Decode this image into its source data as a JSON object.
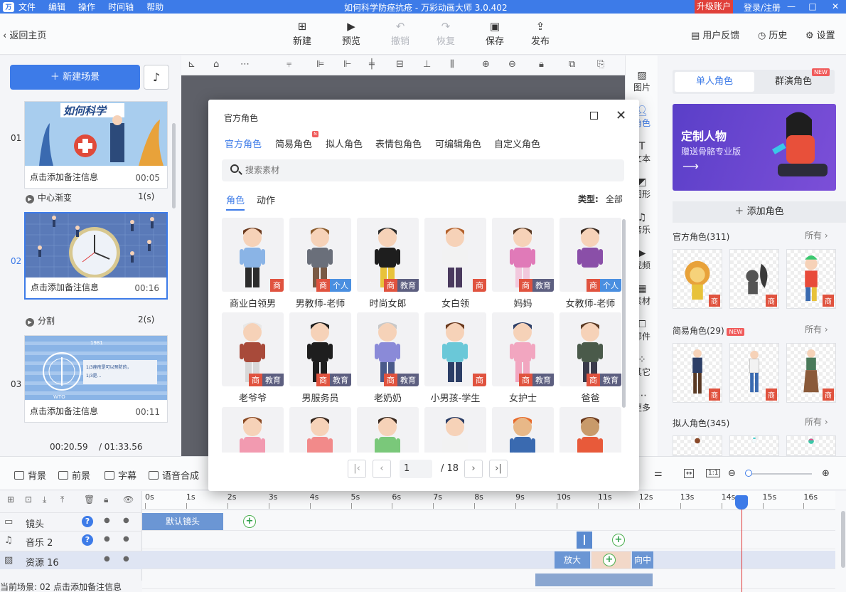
{
  "titlebar": {
    "logo": "万",
    "menus": [
      "文件",
      "编辑",
      "操作",
      "时间轴",
      "帮助"
    ],
    "title": "如何科学防痤抗疮 - 万彩动画大师 3.0.402",
    "upgrade": "升级账户",
    "login": "登录/注册",
    "window_buttons": [
      "—",
      "□",
      "✕"
    ]
  },
  "toolbar": {
    "back": "返回主页",
    "buttons": [
      {
        "label": "新建",
        "icon": "plus-square-icon"
      },
      {
        "label": "预览",
        "icon": "play-icon"
      },
      {
        "label": "撤销",
        "icon": "undo-icon",
        "disabled": true
      },
      {
        "label": "恢复",
        "icon": "redo-icon",
        "disabled": true
      },
      {
        "label": "保存",
        "icon": "save-icon"
      },
      {
        "label": "发布",
        "icon": "publish-icon"
      }
    ],
    "right": [
      "用户反馈",
      "历史",
      "设置"
    ]
  },
  "left": {
    "new_scene": "新建场景",
    "scenes": [
      {
        "num": "01",
        "note": "点击添加备注信息",
        "duration": "00:05",
        "thumb_title": "如何科学",
        "transition": "中心渐变",
        "transition_time": "1(s)"
      },
      {
        "num": "02",
        "note": "点击添加备注信息",
        "duration": "00:16",
        "transition": "分割",
        "transition_time": "2(s)"
      },
      {
        "num": "03",
        "note": "点击添加备注信息",
        "duration": "00:11",
        "thumb_title": "1981",
        "thumb_sub": "WTO",
        "thumb_text1": "1/3痤疮是可以预防的，",
        "thumb_text2": "1/3是..."
      }
    ],
    "current_time": "00:20.59",
    "total_time": "/ 01:33.56"
  },
  "iconstrip": [
    {
      "label": "图片",
      "icon": "image-icon"
    },
    {
      "label": "角色",
      "icon": "character-icon",
      "active": true
    },
    {
      "label": "文本",
      "icon": "text-icon"
    },
    {
      "label": "图形",
      "icon": "shape-icon"
    },
    {
      "label": "音乐",
      "icon": "music-icon"
    },
    {
      "label": "视频",
      "icon": "video-icon"
    },
    {
      "label": "素材",
      "icon": "material-icon"
    },
    {
      "label": "部件",
      "icon": "widget-icon"
    },
    {
      "label": "其它",
      "icon": "other-icon"
    },
    {
      "label": "更多",
      "icon": "more-icon"
    }
  ],
  "right": {
    "tabs": [
      "单人角色",
      "群演角色"
    ],
    "new_badge": "NEW",
    "banner_title": "定制人物",
    "banner_sub": "赠送骨骼专业版",
    "add_role": "添加角色",
    "sections": [
      {
        "title": "官方角色(311)",
        "more": "所有"
      },
      {
        "title": "简易角色(29)",
        "more": "所有",
        "badge": "NEW"
      },
      {
        "title": "拟人角色(345)",
        "more": "所有"
      }
    ],
    "tag": "商"
  },
  "layerbar": {
    "items": [
      "背景",
      "前景",
      "字幕",
      "语音合成"
    ]
  },
  "timeline": {
    "tracks": [
      {
        "label": "镜头",
        "icon": "camera-icon"
      },
      {
        "label": "音乐 2",
        "icon": "music-icon"
      },
      {
        "label": "资源 16",
        "icon": "image-icon"
      }
    ],
    "ticks": [
      "0s",
      "1s",
      "2s",
      "3s",
      "4s",
      "5s",
      "6s",
      "7s",
      "8s",
      "9s",
      "10s",
      "11s",
      "12s",
      "13s",
      "14s",
      "15s",
      "16s"
    ],
    "default_lens": "默认镜头",
    "clip_zoom": "放大",
    "clip_center": "向中",
    "status": "当前场景: 02   点击添加备注信息"
  },
  "dialog": {
    "title": "官方角色",
    "tabs": [
      "官方角色",
      "简易角色",
      "拟人角色",
      "表情包角色",
      "可编辑角色",
      "自定义角色"
    ],
    "new_dot": "N",
    "search_placeholder": "搜索素材",
    "subtabs": [
      "角色",
      "动作"
    ],
    "type_label": "类型:",
    "type_value": "全部",
    "tags": {
      "shang": "商",
      "jiaoyu": "教育",
      "geren": "个人"
    },
    "characters": [
      {
        "name": "商业白领男",
        "tags": [
          "shang"
        ],
        "shirt": "#8ab4e6",
        "pants": "#2c2c2c",
        "hair": "#6b3a1e",
        "skin": "#f6d2b8"
      },
      {
        "name": "男教师-老师",
        "tags": [
          "shang",
          "geren"
        ],
        "shirt": "#6a6f7a",
        "pants": "#7a5a44",
        "hair": "#8a5a2b",
        "skin": "#f6d2b8"
      },
      {
        "name": "时尚女郎",
        "tags": [
          "shang",
          "jiaoyu"
        ],
        "shirt": "#1e1e1e",
        "pants": "#e8c23a",
        "hair": "#2b2b2b",
        "skin": "#f6d2b8"
      },
      {
        "name": "女白领",
        "tags": [
          "shang"
        ],
        "shirt": "#f2f2f2",
        "pants": "#4a3a5e",
        "hair": "#b3612c",
        "skin": "#f6d2b8"
      },
      {
        "name": "妈妈",
        "tags": [
          "shang",
          "jiaoyu"
        ],
        "shirt": "#e07ab8",
        "pants": "#f2c8dd",
        "hair": "#5a3a24",
        "skin": "#f6d2b8"
      },
      {
        "name": "女教师-老师",
        "tags": [
          "shang",
          "geren"
        ],
        "shirt": "#8a4fa8",
        "pants": "#f2f2f2",
        "hair": "#3a2a20",
        "skin": "#f6d2b8"
      },
      {
        "name": "老爷爷",
        "tags": [
          "shang",
          "jiaoyu"
        ],
        "shirt": "#a84a3a",
        "pants": "#d8d8d8",
        "hair": "#e8e8e8",
        "skin": "#f6d2b8"
      },
      {
        "name": "男服务员",
        "tags": [
          "shang",
          "jiaoyu"
        ],
        "shirt": "#1e1e1e",
        "pants": "#1e1e1e",
        "hair": "#1e1e1e",
        "skin": "#f6d2b8"
      },
      {
        "name": "老奶奶",
        "tags": [
          "shang",
          "jiaoyu"
        ],
        "shirt": "#8a8ad8",
        "pants": "#4a5a8a",
        "hair": "#c8c8c8",
        "skin": "#f6d2b8"
      },
      {
        "name": "小男孩-学生",
        "tags": [
          "shang"
        ],
        "shirt": "#6ac8d8",
        "pants": "#2c3e66",
        "hair": "#6b3a1e",
        "skin": "#f6d2b8"
      },
      {
        "name": "女护士",
        "tags": [
          "shang",
          "jiaoyu"
        ],
        "shirt": "#f2a6c0",
        "pants": "#f2a6c0",
        "hair": "#2c3e66",
        "skin": "#f6d2b8"
      },
      {
        "name": "爸爸",
        "tags": [
          "shang",
          "jiaoyu"
        ],
        "shirt": "#4a5a4a",
        "pants": "#3a3a4a",
        "hair": "#5a3a24",
        "skin": "#f6d2b8"
      },
      {
        "name": "",
        "tags": [],
        "shirt": "#f29ab0",
        "pants": "#f2f2f2",
        "hair": "#8a4a24",
        "skin": "#f6d2b8"
      },
      {
        "name": "",
        "tags": [],
        "shirt": "#f28a8a",
        "pants": "#f2f2f2",
        "hair": "#3a2a20",
        "skin": "#f6d2b8"
      },
      {
        "name": "",
        "tags": [],
        "shirt": "#7ac87a",
        "pants": "#f2f2f2",
        "hair": "#3a2a20",
        "skin": "#f6d2b8"
      },
      {
        "name": "",
        "tags": [],
        "shirt": "#f2f2f2",
        "pants": "#f2f2f2",
        "hair": "#2c3e66",
        "skin": "#f6d2b8"
      },
      {
        "name": "",
        "tags": [],
        "shirt": "#3a6ab0",
        "pants": "#3a6ab0",
        "hair": "#e86a2a",
        "skin": "#e8b888"
      },
      {
        "name": "",
        "tags": [],
        "shirt": "#e85a3a",
        "pants": "#e8c23a",
        "hair": "#6b3a1e",
        "skin": "#c89a6a"
      }
    ],
    "pager": {
      "page": "1",
      "total": "/ 18"
    }
  },
  "colors": {
    "accent": "#3d7be8",
    "tag_shang": "#e0533f",
    "tag_jiaoyu": "#5d5f80",
    "tag_geren": "#4a8fe0"
  }
}
